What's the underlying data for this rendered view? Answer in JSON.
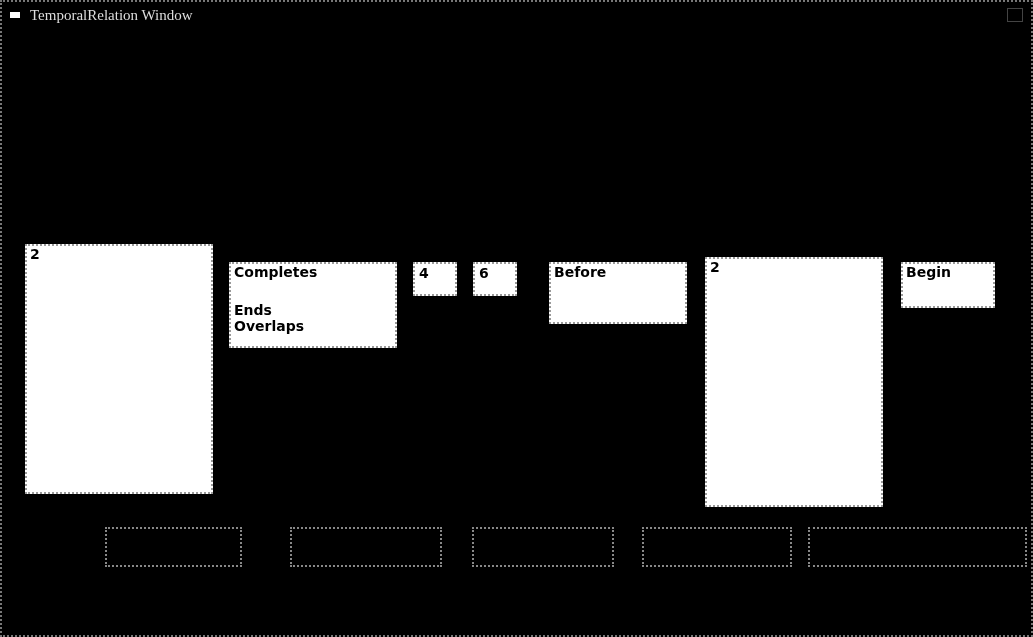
{
  "window": {
    "title": "TemporalRelation Window"
  },
  "first_event_list": {
    "items": [
      {
        "label": "2",
        "selected": false
      }
    ]
  },
  "relation_list": {
    "items": [
      {
        "label": "Completes",
        "selected": false
      },
      {
        "label": "Ends",
        "selected": false
      },
      {
        "label": "Overlaps",
        "selected": false
      }
    ]
  },
  "fields": [
    {
      "value": "4"
    },
    {
      "value": "6"
    }
  ],
  "order_list": {
    "items": [
      {
        "label": "Before",
        "selected": false
      }
    ]
  },
  "second_event_list": {
    "items": [
      {
        "label": "2",
        "selected": false
      }
    ]
  },
  "point_list": {
    "items": [
      {
        "label": "Begin",
        "selected": false
      }
    ]
  },
  "buttons": [
    {
      "kind": "push"
    },
    {
      "kind": "push"
    },
    {
      "kind": "push"
    },
    {
      "kind": "push"
    },
    {
      "kind": "push"
    }
  ]
}
